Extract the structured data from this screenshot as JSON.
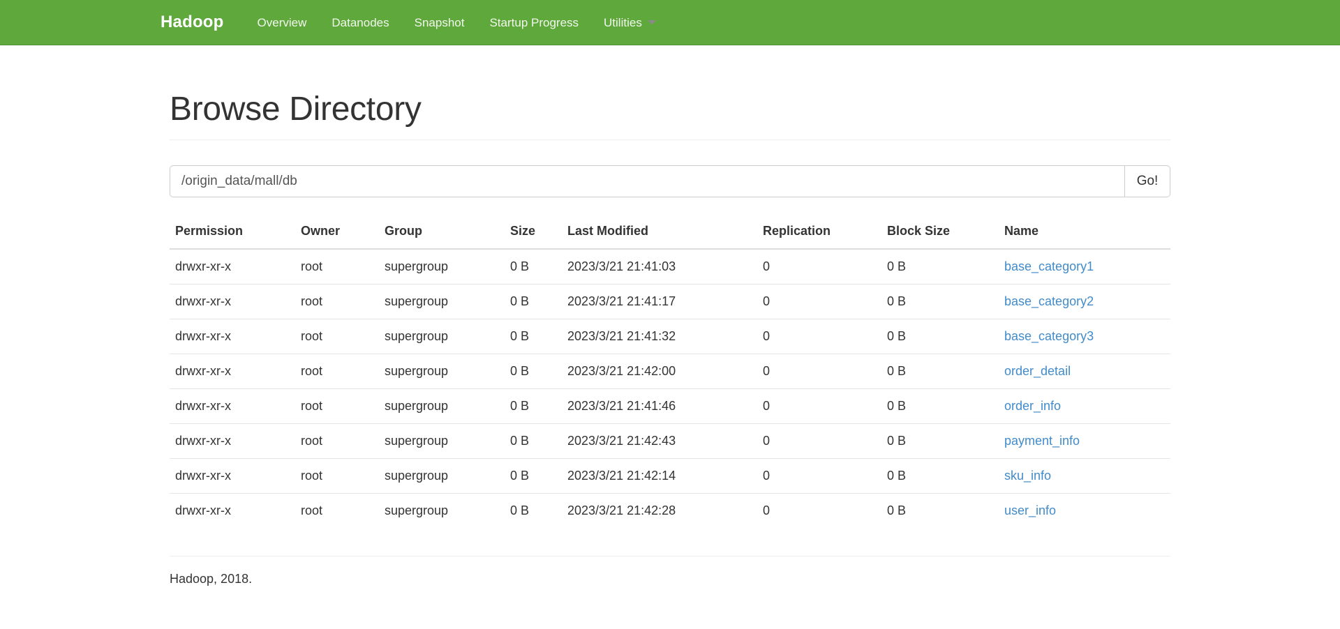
{
  "navbar": {
    "brand": "Hadoop",
    "brand_color": "#ffffff",
    "background_color": "#5fa83c",
    "items": [
      {
        "label": "Overview",
        "has_caret": false
      },
      {
        "label": "Datanodes",
        "has_caret": false
      },
      {
        "label": "Snapshot",
        "has_caret": false
      },
      {
        "label": "Startup Progress",
        "has_caret": false
      },
      {
        "label": "Utilities",
        "has_caret": true
      }
    ]
  },
  "page": {
    "title": "Browse Directory"
  },
  "path_bar": {
    "value": "/origin_data/mall/db",
    "placeholder": "Enter a path",
    "go_label": "Go!"
  },
  "table": {
    "columns": [
      "Permission",
      "Owner",
      "Group",
      "Size",
      "Last Modified",
      "Replication",
      "Block Size",
      "Name"
    ],
    "rows": [
      {
        "permission": "drwxr-xr-x",
        "owner": "root",
        "group": "supergroup",
        "size": "0 B",
        "last_modified": "2023/3/21 21:41:03",
        "replication": "0",
        "block_size": "0 B",
        "name": "base_category1"
      },
      {
        "permission": "drwxr-xr-x",
        "owner": "root",
        "group": "supergroup",
        "size": "0 B",
        "last_modified": "2023/3/21 21:41:17",
        "replication": "0",
        "block_size": "0 B",
        "name": "base_category2"
      },
      {
        "permission": "drwxr-xr-x",
        "owner": "root",
        "group": "supergroup",
        "size": "0 B",
        "last_modified": "2023/3/21 21:41:32",
        "replication": "0",
        "block_size": "0 B",
        "name": "base_category3"
      },
      {
        "permission": "drwxr-xr-x",
        "owner": "root",
        "group": "supergroup",
        "size": "0 B",
        "last_modified": "2023/3/21 21:42:00",
        "replication": "0",
        "block_size": "0 B",
        "name": "order_detail"
      },
      {
        "permission": "drwxr-xr-x",
        "owner": "root",
        "group": "supergroup",
        "size": "0 B",
        "last_modified": "2023/3/21 21:41:46",
        "replication": "0",
        "block_size": "0 B",
        "name": "order_info"
      },
      {
        "permission": "drwxr-xr-x",
        "owner": "root",
        "group": "supergroup",
        "size": "0 B",
        "last_modified": "2023/3/21 21:42:43",
        "replication": "0",
        "block_size": "0 B",
        "name": "payment_info"
      },
      {
        "permission": "drwxr-xr-x",
        "owner": "root",
        "group": "supergroup",
        "size": "0 B",
        "last_modified": "2023/3/21 21:42:14",
        "replication": "0",
        "block_size": "0 B",
        "name": "sku_info"
      },
      {
        "permission": "drwxr-xr-x",
        "owner": "root",
        "group": "supergroup",
        "size": "0 B",
        "last_modified": "2023/3/21 21:42:28",
        "replication": "0",
        "block_size": "0 B",
        "name": "user_info"
      }
    ]
  },
  "footer": {
    "text": "Hadoop, 2018."
  },
  "colors": {
    "navbar_green": "#5fa83c",
    "link_blue": "#428bca",
    "text_dark": "#333333",
    "border_light": "#e4e4e4"
  }
}
